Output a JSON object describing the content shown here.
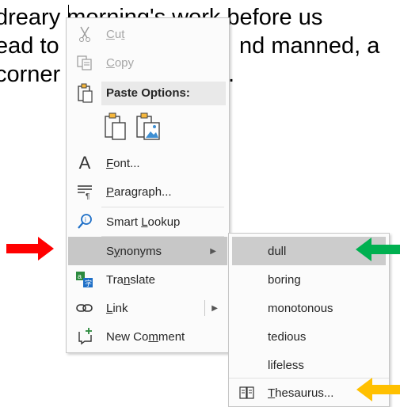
{
  "document": {
    "lines": [
      "dreary morning's work before us",
      "ead to",
      "nd manned, a",
      "corner"
    ],
    "period": "."
  },
  "context_menu": {
    "cut": "Cut",
    "copy": "Copy",
    "paste_options": "Paste Options:",
    "font": "Font...",
    "paragraph": "Paragraph...",
    "smart_lookup": "Smart Lookup",
    "synonyms": "Synonyms",
    "translate": "Translate",
    "link": "Link",
    "new_comment": "New Comment"
  },
  "synonyms_submenu": {
    "items": [
      "dull",
      "boring",
      "monotonous",
      "tedious",
      "lifeless"
    ],
    "thesaurus": "Thesaurus..."
  },
  "annotations": {
    "red_arrow_color": "#ff0000",
    "green_arrow_color": "#00b050",
    "yellow_arrow_color": "#ffc000"
  },
  "icons": {
    "cut": "scissors-icon",
    "copy": "copy-icon",
    "paste": "clipboard-icon",
    "font": "font-icon",
    "paragraph": "paragraph-icon",
    "smart_lookup": "magnifier-icon",
    "translate": "translate-icon",
    "link": "link-icon",
    "new_comment": "comment-icon",
    "thesaurus": "book-icon"
  }
}
